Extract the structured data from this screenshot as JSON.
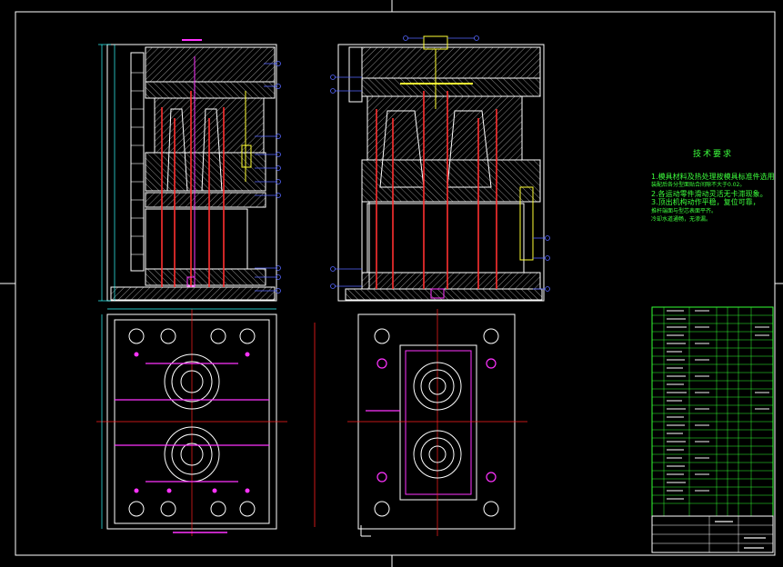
{
  "notes": {
    "title": "技术要求",
    "lines": [
      "1.模具材料及热处理按模具标准件选用。",
      "装配后各分型面贴合间隙不大于0.02。",
      "2.各运动零件滑动灵活无卡滞现象。",
      "3.顶出机构动作平稳，复位可靠，",
      "推杆端面与型芯表面平齐。",
      "冷却水道通畅，无渗漏。"
    ]
  },
  "colors": {
    "background": "#000000",
    "frame": "#ffffff",
    "outline": "#ffffff",
    "hatch": "#9a9a9a",
    "rod": "#ff3030",
    "centerline": "#ff2020",
    "dimension": "#33ffff",
    "balloon": "#5566ff",
    "bom_grid": "#33ff33",
    "bom_text": "#dddddd",
    "notes_text": "#3dff3d",
    "accent_magenta": "#ff33ff",
    "accent_yellow": "#ffff33"
  }
}
